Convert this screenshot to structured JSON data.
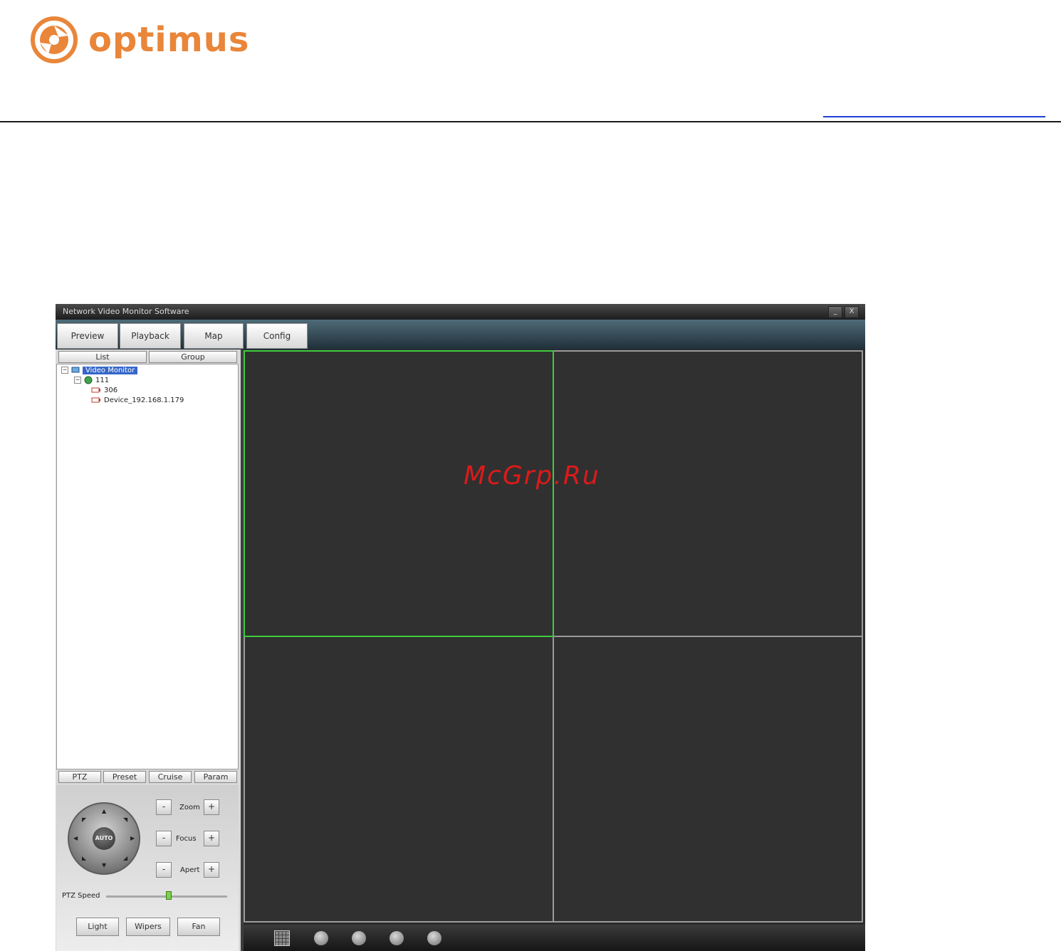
{
  "brand": {
    "name": "optimus",
    "color": "#e9863a"
  },
  "window": {
    "title": "Network Video Monitor Software",
    "minimize": "_",
    "close": "X"
  },
  "nav_tabs": [
    "Preview",
    "Playback",
    "Map",
    "Config"
  ],
  "device_tabs": [
    "List",
    "Group"
  ],
  "tree": {
    "root": "Video Monitor",
    "group": "111",
    "devices": [
      "306",
      "Device_192.168.1.179"
    ]
  },
  "ptz_tabs": [
    "PTZ",
    "Preset",
    "Cruise",
    "Param"
  ],
  "ptz": {
    "center": "AUTO",
    "minus": "-",
    "plus": "+",
    "zoom": "Zoom",
    "focus": "Focus",
    "aperture": "Apert",
    "speed_label": "PTZ Speed",
    "speed_value": 0.52,
    "buttons": [
      "Light",
      "Wipers",
      "Fan"
    ]
  },
  "video": {
    "layout": "2x2",
    "active_cell": 1,
    "active_color": "#3ecb3e"
  },
  "toolbar_icons": [
    "layout-grid-icon",
    "record-icon",
    "previous-icon",
    "next-icon",
    "stop-icon"
  ],
  "watermark": "McGrp.Ru"
}
